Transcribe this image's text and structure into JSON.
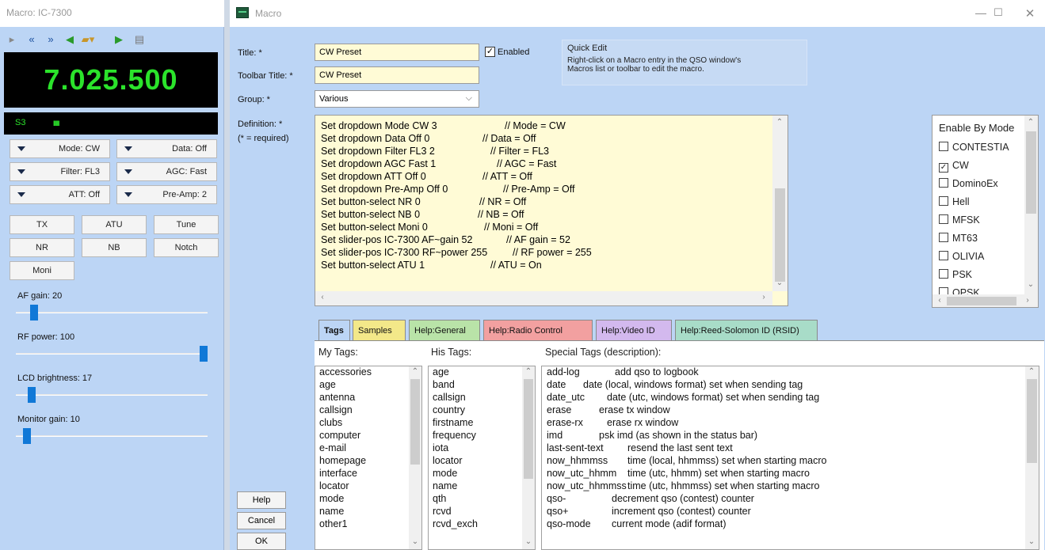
{
  "radio": {
    "window_title": "Macro: IC-7300",
    "frequency": "7.025.500",
    "smeter_label": "S3",
    "smeter_bars": "IIIII",
    "dropdowns": [
      {
        "label": "Mode: CW"
      },
      {
        "label": "Data: Off"
      },
      {
        "label": "Filter: FL3"
      },
      {
        "label": "AGC: Fast"
      },
      {
        "label": "ATT: Off"
      },
      {
        "label": "Pre-Amp: 2"
      }
    ],
    "buttons": [
      "TX",
      "ATU",
      "Tune",
      "NR",
      "NB",
      "Notch",
      "Moni"
    ],
    "sliders": [
      {
        "label": "AF gain: 20",
        "value": 20,
        "max": 255
      },
      {
        "label": "RF power: 100",
        "value": 100,
        "max": 100
      },
      {
        "label": "LCD brightness: 17",
        "value": 17,
        "max": 255
      },
      {
        "label": "Monitor gain: 10",
        "value": 10,
        "max": 255
      }
    ]
  },
  "macro": {
    "window_title": "Macro",
    "title_label": "Title: *",
    "title_value": "CW Preset",
    "toolbar_title_label": "Toolbar Title: *",
    "toolbar_title_value": "CW Preset",
    "group_label": "Group: *",
    "group_value": "Various",
    "enabled_label": "Enabled",
    "enabled": true,
    "definition_label": "Definition: *",
    "required_note": "(* = required)",
    "quick_edit": {
      "heading": "Quick Edit",
      "line1": "Right-click on a Macro entry in the QSO window's",
      "line2": "Macros list or toolbar to edit the macro."
    },
    "definition": [
      {
        "cmd": "Set dropdown Mode CW 3",
        "comment": "// Mode = CW"
      },
      {
        "cmd": "Set dropdown Data Off 0",
        "comment": "// Data = Off"
      },
      {
        "cmd": "Set dropdown Filter FL3 2",
        "comment": "// Filter = FL3"
      },
      {
        "cmd": "Set dropdown AGC Fast 1",
        "comment": "// AGC = Fast"
      },
      {
        "cmd": "Set dropdown ATT Off 0",
        "comment": "// ATT = Off"
      },
      {
        "cmd": "Set dropdown Pre-Amp Off 0",
        "comment": "// Pre-Amp = Off"
      },
      {
        "cmd": "Set button-select NR 0",
        "comment": "// NR = Off"
      },
      {
        "cmd": "Set button-select NB 0",
        "comment": "// NB = Off"
      },
      {
        "cmd": "Set button-select Moni 0",
        "comment": "// Moni = Off"
      },
      {
        "cmd": "Set slider-pos IC-7300 AF~gain 52",
        "comment": "// AF gain = 52"
      },
      {
        "cmd": "Set slider-pos IC-7300 RF~power 255",
        "comment": "// RF power = 255"
      },
      {
        "cmd": "Set button-select ATU 1",
        "comment": "// ATU = On"
      }
    ],
    "enable_by_mode": {
      "heading": "Enable By Mode",
      "modes": [
        {
          "name": "CONTESTIA",
          "checked": false
        },
        {
          "name": "CW",
          "checked": true
        },
        {
          "name": "DominoEx",
          "checked": false
        },
        {
          "name": "Hell",
          "checked": false
        },
        {
          "name": "MFSK",
          "checked": false
        },
        {
          "name": "MT63",
          "checked": false
        },
        {
          "name": "OLIVIA",
          "checked": false
        },
        {
          "name": "PSK",
          "checked": false
        },
        {
          "name": "QPSK",
          "checked": false
        }
      ]
    },
    "tabs": [
      {
        "label": "Tags",
        "color": "#bcd5f5",
        "active": true
      },
      {
        "label": "Samples",
        "color": "#f3e889"
      },
      {
        "label": "Help:General",
        "color": "#b9e3a8"
      },
      {
        "label": "Help:Radio Control",
        "color": "#f2a0a0"
      },
      {
        "label": "Help:Video ID",
        "color": "#d3b9ee"
      },
      {
        "label": "Help:Reed-Solomon ID (RSID)",
        "color": "#a8dcc8"
      }
    ],
    "my_tags_header": "My Tags:",
    "his_tags_header": "His Tags:",
    "special_tags_header": "Special Tags (description):",
    "my_tags": [
      "accessories",
      "age",
      "antenna",
      "callsign",
      "clubs",
      "computer",
      "e-mail",
      "homepage",
      "interface",
      "locator",
      "mode",
      "name",
      "other1"
    ],
    "his_tags": [
      "age",
      "band",
      "callsign",
      "country",
      "firstname",
      "frequency",
      "iota",
      "locator",
      "mode",
      "name",
      "qth",
      "rcvd",
      "rcvd_exch"
    ],
    "special_tags": [
      {
        "tag": "add-log",
        "desc": "add qso to logbook"
      },
      {
        "tag": "date",
        "desc": "date (local, windows format) set when sending tag"
      },
      {
        "tag": "date_utc",
        "desc": "date (utc, windows format) set when sending tag"
      },
      {
        "tag": "erase",
        "desc": "erase tx window"
      },
      {
        "tag": "erase-rx",
        "desc": "erase rx window"
      },
      {
        "tag": "imd",
        "desc": "psk imd (as shown in the status bar)"
      },
      {
        "tag": "last-sent-text",
        "desc": "resend the last sent text"
      },
      {
        "tag": "now_hhmmss",
        "desc": "time (local, hhmmss) set when starting macro"
      },
      {
        "tag": "now_utc_hhmm",
        "desc": "time (utc, hhmm) set when starting macro"
      },
      {
        "tag": "now_utc_hhmmss",
        "desc": "time (utc, hhmmss) set when starting macro"
      },
      {
        "tag": "qso-",
        "desc": "decrement qso (contest) counter"
      },
      {
        "tag": "qso+",
        "desc": "increment qso (contest) counter"
      },
      {
        "tag": "qso-mode",
        "desc": "current mode (adif format)"
      }
    ],
    "help_button": "Help",
    "cancel_button": "Cancel",
    "ok_button": "OK"
  }
}
